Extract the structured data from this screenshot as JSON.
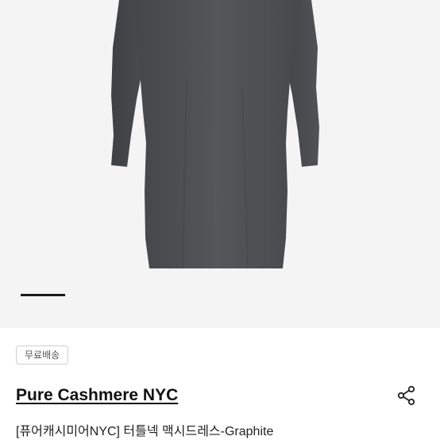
{
  "product": {
    "image_alt": "Graphite turtleneck maxi knit dress",
    "gallery_active_index": 0,
    "shipping_badge": "무료배송",
    "brand": "Pure Cashmere NYC",
    "title": "[퓨어캐시미어NYC] 터틀넥 맥시드레스-Graphite"
  },
  "colors": {
    "background": "#f4f4f4",
    "dress": "#4e4f52",
    "indicator_active": "#1a1a1a"
  },
  "icons": {
    "share": "share-icon"
  }
}
